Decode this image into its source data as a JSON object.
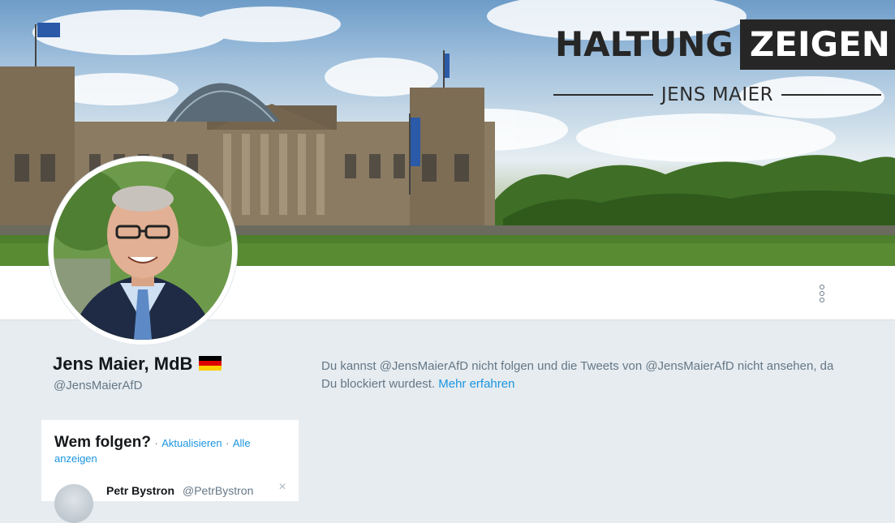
{
  "banner": {
    "brand_main": "HALTUNG",
    "brand_box": "ZEIGEN",
    "brand_sub": "JENS MAIER"
  },
  "profile": {
    "name": "Jens Maier, MdB",
    "handle": "@JensMaierAfD",
    "flag_colors": [
      "#000000",
      "#dd0000",
      "#ffce00"
    ]
  },
  "blocked": {
    "message": "Du kannst @JensMaierAfD nicht folgen und die Tweets von @JensMaierAfD nicht ansehen, da Du blockiert wurdest.",
    "link": "Mehr erfahren"
  },
  "who_to_follow": {
    "title": "Wem folgen?",
    "separator": "·",
    "refresh": "Aktualisieren",
    "show_all": "Alle anzeigen",
    "suggestions": [
      {
        "name": "Petr Bystron",
        "handle": "@PetrBystron",
        "dismiss": "×"
      }
    ]
  },
  "colors": {
    "link": "#1b95e0",
    "muted": "#657786",
    "background": "#e6ecf0"
  }
}
